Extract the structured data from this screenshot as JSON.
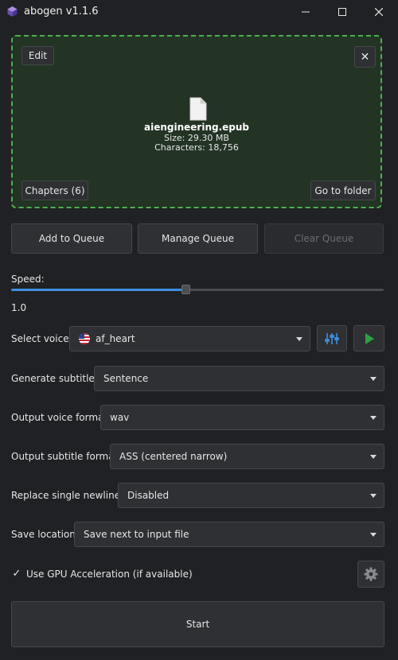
{
  "window": {
    "title": "abogen v1.1.6"
  },
  "file_area": {
    "edit_label": "Edit",
    "close_symbol": "✕",
    "file_name": "aiengineering.epub",
    "size_text": "Size: 29.30 MB",
    "characters_text": "Characters: 18,756",
    "chapters_label": "Chapters (6)",
    "folder_label": "Go to folder"
  },
  "queue": {
    "add_label": "Add to Queue",
    "manage_label": "Manage Queue",
    "clear_label": "Clear Queue"
  },
  "speed": {
    "label": "Speed:",
    "value_text": "1.0",
    "fraction": 0.47
  },
  "voice": {
    "label": "Select voice:",
    "value": "af_heart"
  },
  "subtitles": {
    "label": "Generate subtitles:",
    "value": "Sentence"
  },
  "voice_format": {
    "label": "Output voice format:",
    "value": "wav"
  },
  "subtitle_format": {
    "label": "Output subtitle format:",
    "value": "ASS (centered narrow)"
  },
  "newlines": {
    "label": "Replace single newlines:",
    "value": "Disabled"
  },
  "save_location": {
    "label": "Save location:",
    "value": "Save next to input file"
  },
  "gpu": {
    "label": "Use GPU Acceleration (if available)",
    "checked": true,
    "check_glyph": "✓"
  },
  "start": {
    "label": "Start"
  },
  "colors": {
    "accent_blue": "#3d8fe0",
    "play_green": "#2ea043",
    "drop_border": "#4cb050",
    "drop_bg": "#233425",
    "background": "#202124"
  }
}
